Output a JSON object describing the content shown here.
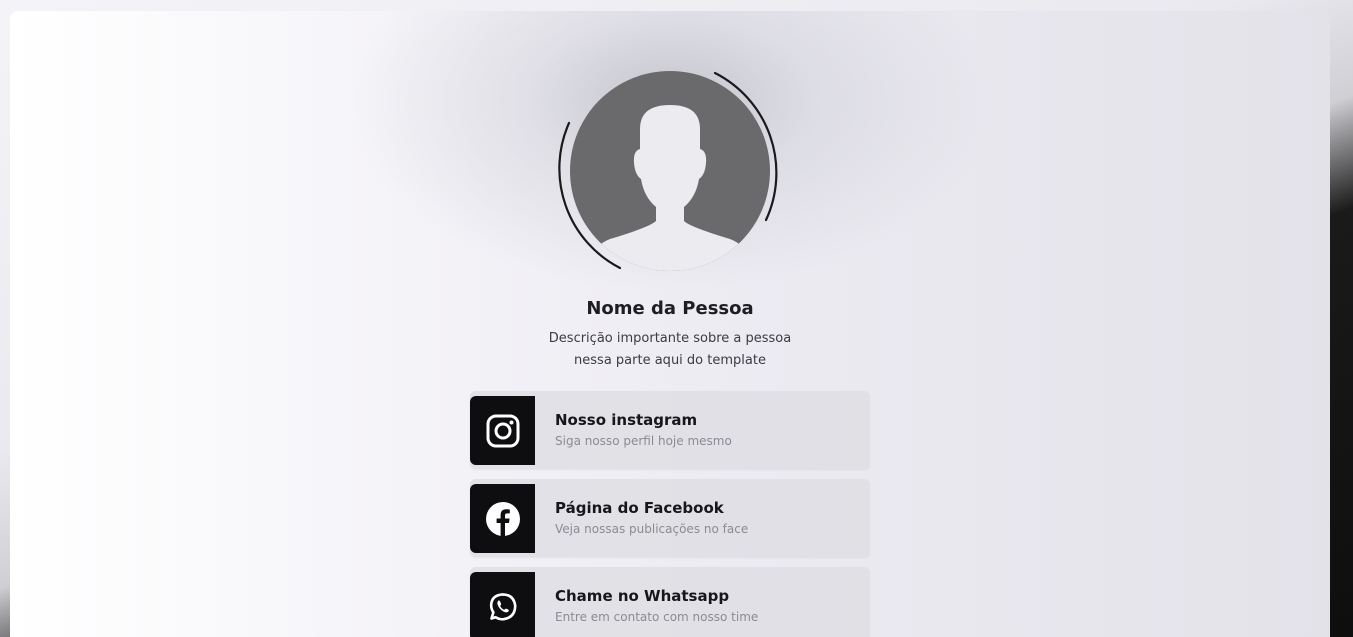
{
  "profile": {
    "name": "Nome da Pessoa",
    "description_line1": "Descrição importante sobre a pessoa",
    "description_line2": "nessa parte aqui do template",
    "avatar_icon": "user-silhouette-icon"
  },
  "links": [
    {
      "title": "Nosso instagram",
      "subtitle": "Siga nosso perfil hoje mesmo",
      "icon": "instagram-icon"
    },
    {
      "title": "Página do Facebook",
      "subtitle": "Veja nossas publicações no face",
      "icon": "facebook-icon"
    },
    {
      "title": "Chame no Whatsapp",
      "subtitle": "Entre em contato com nosso time",
      "icon": "whatsapp-icon"
    }
  ],
  "colors": {
    "icon_box": "#0e0d0f",
    "avatar_bg": "#6a6a6c",
    "avatar_figure": "#ececf0",
    "text_primary": "#17171b",
    "text_secondary": "#8b8b93"
  }
}
